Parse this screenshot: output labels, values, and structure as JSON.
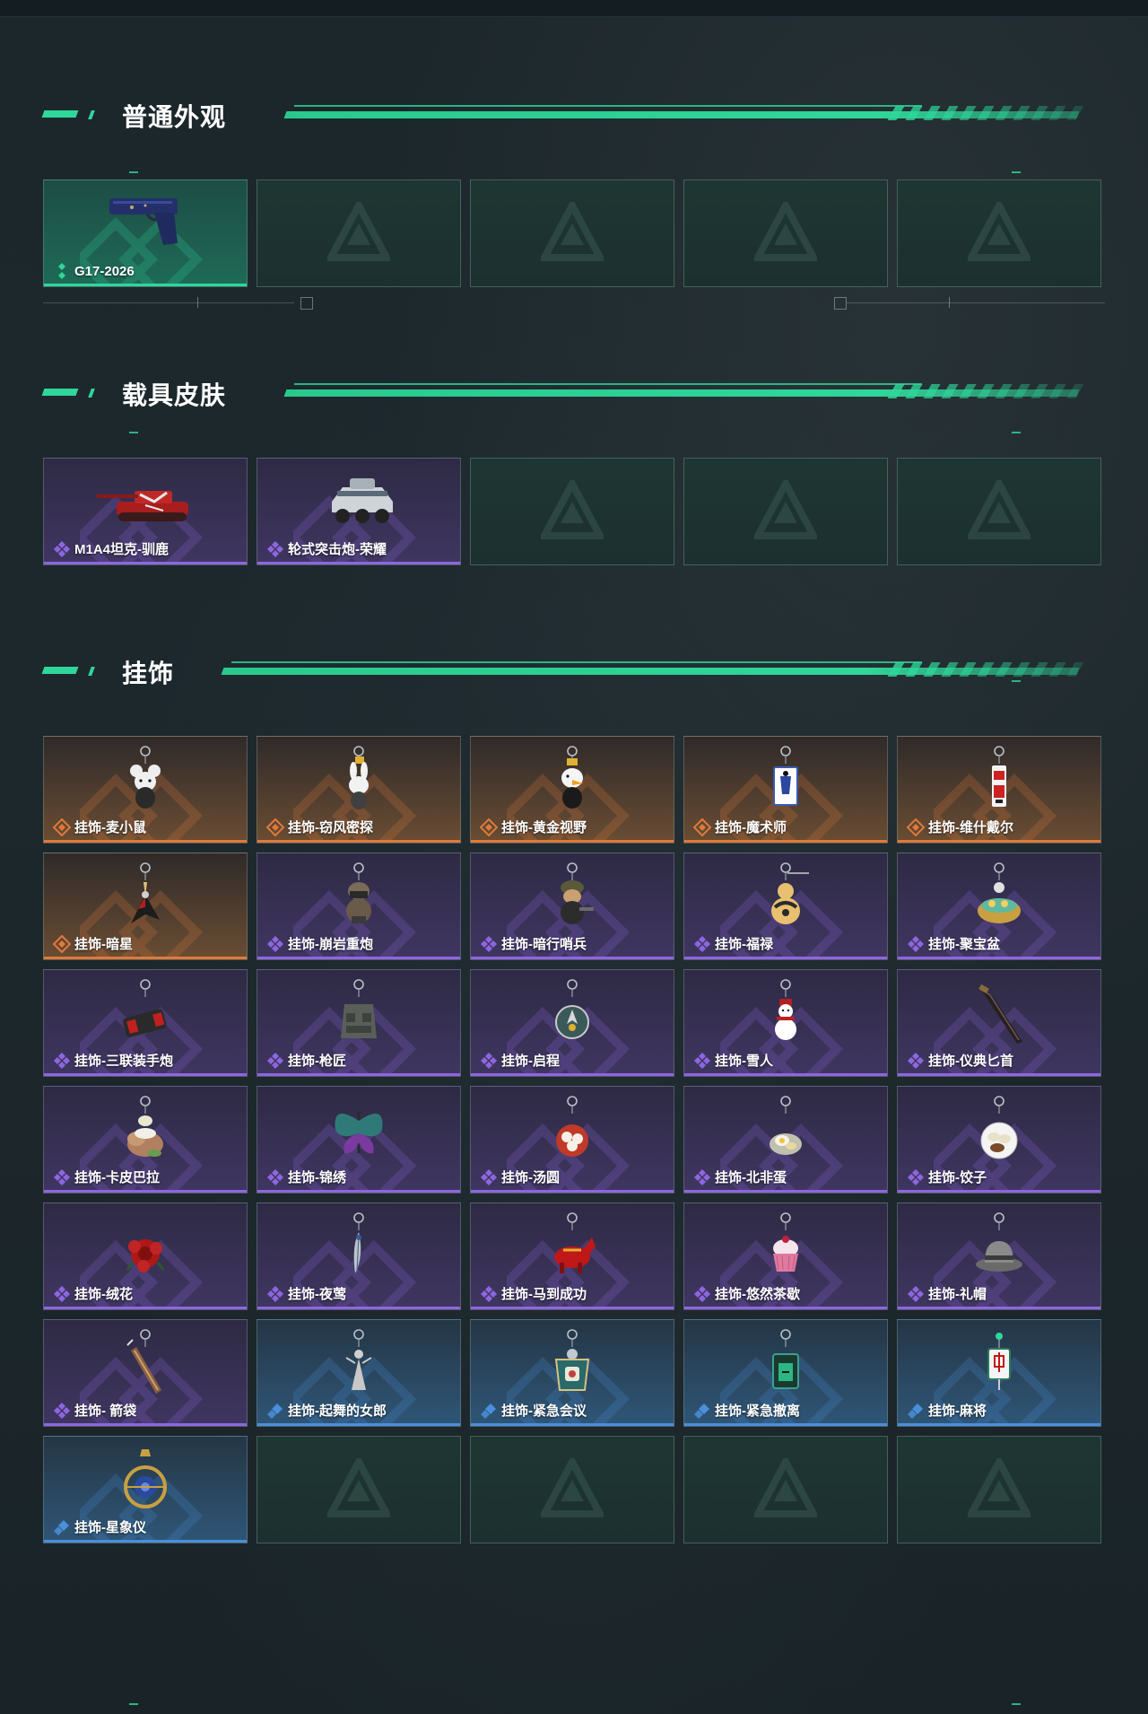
{
  "sections": [
    {
      "title": "普通外观",
      "items": [
        {
          "label": "G17-2026",
          "rarity": "green",
          "image": "pistol"
        }
      ],
      "empty_slots": 4
    },
    {
      "title": "载具皮肤",
      "items": [
        {
          "label": "M1A4坦克-驯鹿",
          "rarity": "purple",
          "image": "tank"
        },
        {
          "label": "轮式突击炮-荣耀",
          "rarity": "purple",
          "image": "armored-car"
        }
      ],
      "empty_slots": 3
    },
    {
      "title": "挂饰",
      "items": [
        {
          "label": "挂饰-麦小鼠",
          "rarity": "orange",
          "image": "mouse-charm"
        },
        {
          "label": "挂饰-窃风密探",
          "rarity": "orange",
          "image": "rabbit-charm"
        },
        {
          "label": "挂饰-黄金视野",
          "rarity": "orange",
          "image": "duck-charm"
        },
        {
          "label": "挂饰-魔术师",
          "rarity": "orange",
          "image": "card-charm"
        },
        {
          "label": "挂饰-维什戴尔",
          "rarity": "orange",
          "image": "tag-charm"
        },
        {
          "label": "挂饰-暗星",
          "rarity": "orange",
          "image": "bird-charm"
        },
        {
          "label": "挂饰-崩岩重炮",
          "rarity": "purple",
          "image": "soldier-charm"
        },
        {
          "label": "挂饰-暗行哨兵",
          "rarity": "purple",
          "image": "soldier-charm-2"
        },
        {
          "label": "挂饰-福禄",
          "rarity": "purple",
          "image": "gourd-charm"
        },
        {
          "label": "挂饰-聚宝盆",
          "rarity": "purple",
          "image": "bowl-charm"
        },
        {
          "label": "挂饰-三联装手炮",
          "rarity": "purple",
          "image": "launcher-charm"
        },
        {
          "label": "挂饰-枪匠",
          "rarity": "purple",
          "image": "vest-charm"
        },
        {
          "label": "挂饰-启程",
          "rarity": "purple",
          "image": "medal-charm"
        },
        {
          "label": "挂饰-雪人",
          "rarity": "purple",
          "image": "snowman-charm"
        },
        {
          "label": "挂饰-仪典匕首",
          "rarity": "purple",
          "image": "dagger-charm"
        },
        {
          "label": "挂饰-卡皮巴拉",
          "rarity": "purple",
          "image": "capybara-charm"
        },
        {
          "label": "挂饰-锦绣",
          "rarity": "purple",
          "image": "butterfly-charm"
        },
        {
          "label": "挂饰-汤圆",
          "rarity": "purple",
          "image": "tangyuan-charm"
        },
        {
          "label": "挂饰-北非蛋",
          "rarity": "purple",
          "image": "egg-charm"
        },
        {
          "label": "挂饰-饺子",
          "rarity": "purple",
          "image": "dumpling-charm"
        },
        {
          "label": "挂饰-绒花",
          "rarity": "purple",
          "image": "flower-charm"
        },
        {
          "label": "挂饰-夜莺",
          "rarity": "purple",
          "image": "feather-charm"
        },
        {
          "label": "挂饰-马到成功",
          "rarity": "purple",
          "image": "horse-charm"
        },
        {
          "label": "挂饰-悠然茶歇",
          "rarity": "purple",
          "image": "cupcake-charm"
        },
        {
          "label": "挂饰-礼帽",
          "rarity": "purple",
          "image": "hat-charm"
        },
        {
          "label": "挂饰- 箭袋",
          "rarity": "purple",
          "image": "quiver-charm"
        },
        {
          "label": "挂饰-起舞的女郎",
          "rarity": "blue",
          "image": "dancer-charm"
        },
        {
          "label": "挂饰-紧急会议",
          "rarity": "blue",
          "image": "meeting-charm"
        },
        {
          "label": "挂饰-紧急撤离",
          "rarity": "blue",
          "image": "exit-charm"
        },
        {
          "label": "挂饰-麻将",
          "rarity": "blue",
          "image": "mahjong-charm"
        },
        {
          "label": "挂饰-星象仪",
          "rarity": "blue",
          "image": "astrolabe-charm"
        }
      ],
      "empty_slots": 4
    }
  ],
  "colors": {
    "accent": "#2fd79a",
    "green": "#2fd79a",
    "purple": "#8e66e0",
    "orange": "#e07a3a",
    "blue": "#4a8fdb"
  }
}
